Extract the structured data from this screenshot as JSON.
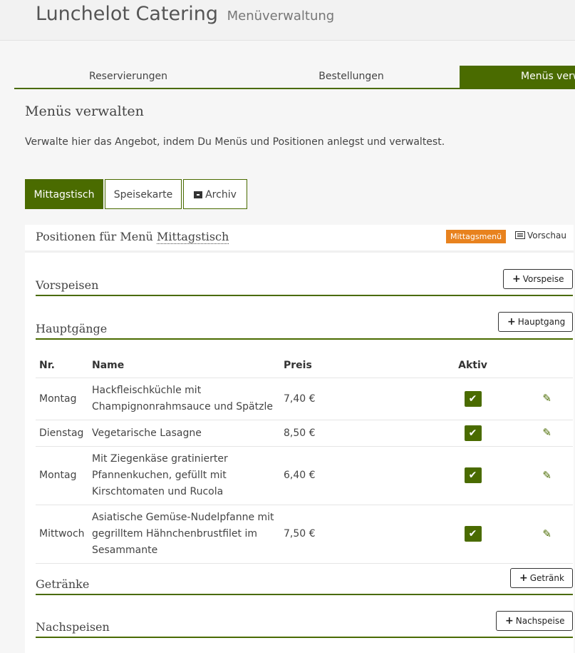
{
  "header": {
    "brand": "Lunchelot Catering",
    "subtitle": "Menüverwaltung"
  },
  "nav": {
    "tabs": [
      "Reservierungen",
      "Bestellungen",
      "Menüs verw"
    ],
    "active_index": 2
  },
  "page": {
    "title": "Menüs verwalten",
    "description": "Verwalte hier das Angebot, indem Du Menüs und Positionen anlegst und verwaltest."
  },
  "subtabs": [
    "Mittagstisch",
    "Speisekarte",
    "Archiv"
  ],
  "panel": {
    "title_prefix": "Positionen für Menü",
    "menu_name": "Mittagstisch",
    "badge": "Mittagsmenü",
    "preview": "Vorschau"
  },
  "sections": [
    {
      "title": "Vorspeisen",
      "button": "Vorspeise"
    },
    {
      "title": "Hauptgänge",
      "button": "Hauptgang"
    },
    {
      "title": "Getränke",
      "button": "Getränk"
    },
    {
      "title": "Nachspeisen",
      "button": "Nachspeise"
    }
  ],
  "table": {
    "headers": [
      "Nr.",
      "Name",
      "Preis",
      "Aktiv"
    ],
    "rows": [
      {
        "nr": "Montag",
        "name": "Hackfleischküchle mit Champignonrahmsauce und Spätzle",
        "price": "7,40 €",
        "active": true
      },
      {
        "nr": "Dienstag",
        "name": "Vegetarische Lasagne",
        "price": "8,50 €",
        "active": true
      },
      {
        "nr": "Montag",
        "name": "Mit Ziegenkäse gratinierter Pfannenkuchen, gefüllt mit Kirschtomaten und Rucola",
        "price": "6,40 €",
        "active": true
      },
      {
        "nr": "Mittwoch",
        "name": "Asiatische Gemüse-Nudelpfanne mit gegrilltem Hähnchenbrustfilet im Sesammante",
        "price": "7,50 €",
        "active": true
      }
    ]
  },
  "icons": {
    "check": "checkmark-icon",
    "edit": "pencil-icon",
    "add": "plus-icon",
    "archive": "archive-icon",
    "preview": "preview-icon"
  },
  "colors": {
    "primary": "#4a6b00",
    "badge": "#e8821e"
  }
}
